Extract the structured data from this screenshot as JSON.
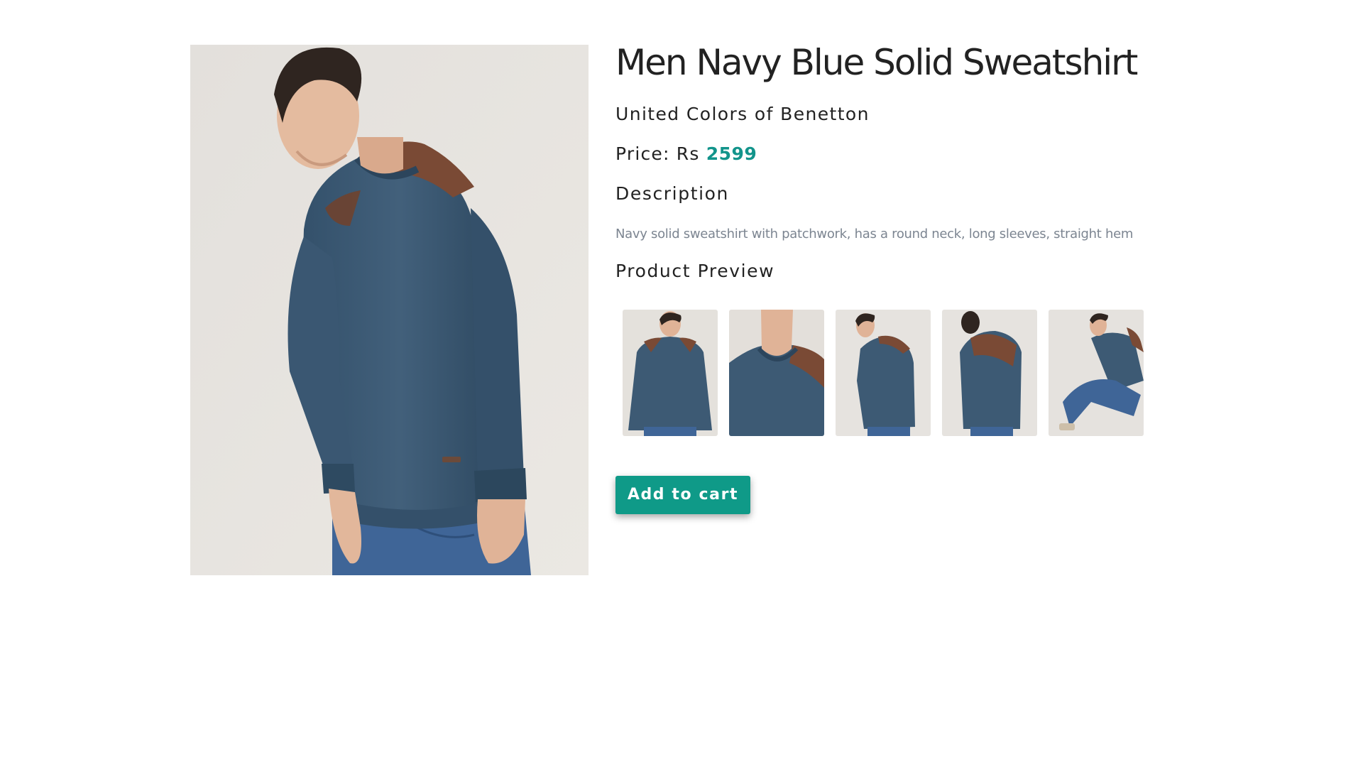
{
  "product": {
    "title": "Men Navy Blue Solid Sweatshirt",
    "brand": "United Colors of Benetton",
    "price_label": "Price: Rs",
    "price_value": "2599",
    "description_heading": "Description",
    "description_text": "Navy solid sweatshirt with patchwork, has a round neck, long sleeves, straight hem",
    "preview_heading": "Product Preview",
    "add_to_cart_label": "Add to cart"
  },
  "colors": {
    "accent": "#12948b",
    "button": "#0f9a88",
    "sweater": "#3d5a74",
    "patch": "#7a4a35",
    "jeans": "#3f6597",
    "backdrop": "#e6e2dc",
    "muted_text": "#7c8591"
  },
  "thumbnails": [
    {
      "view": "front"
    },
    {
      "view": "neck-closeup"
    },
    {
      "view": "side"
    },
    {
      "view": "back"
    },
    {
      "view": "seated"
    }
  ]
}
